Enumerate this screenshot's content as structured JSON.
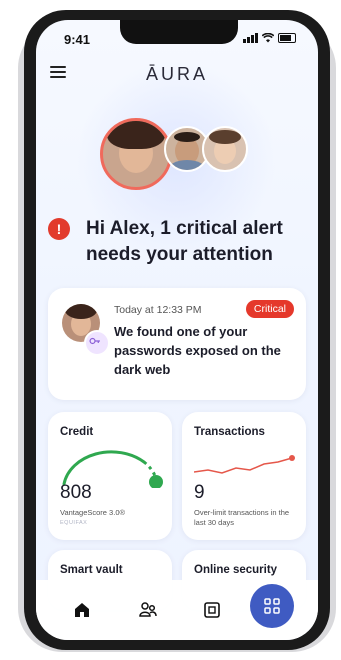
{
  "status": {
    "time": "9:41"
  },
  "brand": {
    "logo": "ĀURA"
  },
  "alert": {
    "headline": "Hi Alex, 1 critical alert needs your attention",
    "icon": "!"
  },
  "alert_card": {
    "time": "Today at 12:33 PM",
    "badge": "Critical",
    "message": "We found one of your passwords exposed on the dark web"
  },
  "tiles": {
    "credit": {
      "title": "Credit",
      "value": "808",
      "label": "VantageScore 3.0®",
      "provider": "EQUIFAX"
    },
    "transactions": {
      "title": "Transactions",
      "value": "9",
      "label": "Over-limit transactions in the last 30 days"
    },
    "smart_vault": {
      "title": "Smart vault"
    },
    "online_security": {
      "title": "Online security"
    }
  },
  "colors": {
    "accent": "#3f5bc2",
    "critical": "#e5382b",
    "gauge": "#2fa84f",
    "trend": "#e5574a"
  },
  "nav": {
    "items": [
      "home-icon",
      "family-icon",
      "vault-icon",
      "apps-icon"
    ]
  }
}
